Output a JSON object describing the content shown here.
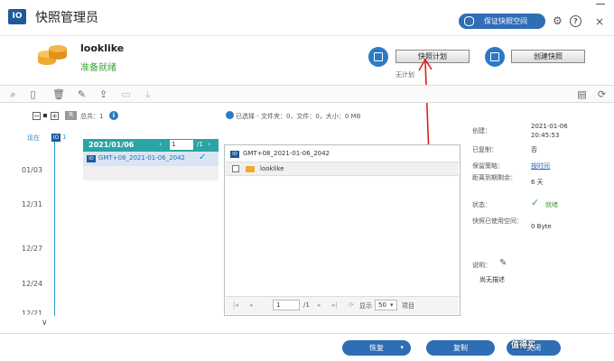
{
  "title_bar": {
    "logo": "IO",
    "title": "快照管理员",
    "protect_button": "保证快照空间",
    "icons": [
      "gear-icon",
      "help-icon"
    ],
    "help_symbol": "?",
    "window_min_icon": "minimize-icon",
    "window_close_symbol": "×"
  },
  "volume": {
    "name": "looklike",
    "status": "准备就绪"
  },
  "actions": {
    "schedule_button": "快照计划",
    "no_plan_text": "无计划",
    "create_button": "创建快照"
  },
  "timeline": {
    "now_label": "现在",
    "now_badge": "IO",
    "now_count": "1",
    "dates": [
      "01/03",
      "12/31",
      "12/27",
      "12/24",
      "12/21"
    ]
  },
  "controls": {
    "minus_symbol": "−",
    "plus_symbol": "+",
    "day_button": "天",
    "total_label": "总共：1",
    "info_symbol": "i"
  },
  "selection_summary": "已选择 - 文件夹：0，文件：0，大小：0 MB",
  "snapshot_list": {
    "date": "2021/01/06",
    "prev_symbol": "‹",
    "page": "1",
    "page_total": "/1",
    "next_symbol": "›",
    "item_badge": "IO",
    "item_name": "GMT+08_2021-01-06_2042",
    "item_check": "✓"
  },
  "file_browser": {
    "path_badge": "IO",
    "path": "GMT+08_2021-01-06_2042",
    "rows": [
      {
        "name": "looklike"
      }
    ],
    "pager": {
      "first": "|◂",
      "prev": "◂",
      "page": "1",
      "total": "/1",
      "next": "▸",
      "last": "▸|",
      "refresh": "⟳",
      "show_label": "显示",
      "per_page": "50",
      "unit": "项目"
    }
  },
  "details": {
    "created_label": "创建：",
    "created_value_date": "2021-01-06",
    "created_value_time": "20:45:53",
    "copied_label": "已复制：",
    "copied_value": "否",
    "policy_label": "保留策略：",
    "policy_value": "按时间",
    "expire_label": "距离到期剩余：",
    "expire_value": "6 天",
    "status_label": "状态：",
    "status_value": "就绪",
    "used_label": "快照已使用空间：",
    "used_value": "0 Byte",
    "note_label": "说明：",
    "note_value": "尚无描述"
  },
  "footer": {
    "restore": "恢复",
    "copy": "复制",
    "close": "关闭"
  },
  "watermark": "值得买"
}
